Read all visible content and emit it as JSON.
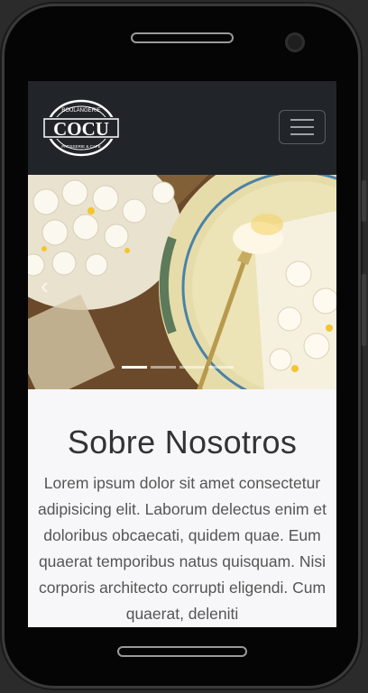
{
  "brand": {
    "logo_text": "COCU",
    "logo_top_text": "BOULANGERIE",
    "logo_bottom_text": "PATISSERIE & CAFÉ"
  },
  "icons": {
    "menu": "hamburger-icon",
    "prev": "chevron-left-icon"
  },
  "carousel": {
    "prev_glyph": "‹",
    "slides_total": 4,
    "active_slide": 1
  },
  "about": {
    "title": "Sobre Nosotros",
    "text": "Lorem ipsum dolor sit amet consectetur adipisicing elit. Laborum delectus enim et doloribus obcaecati, quidem quae. Eum quaerat temporibus natus quisquam. Nisi corporis architecto corrupti eligendi. Cum quaerat, deleniti"
  },
  "colors": {
    "navbar": "#212529",
    "page_bg": "#f7f7f9",
    "text": "#555555"
  }
}
